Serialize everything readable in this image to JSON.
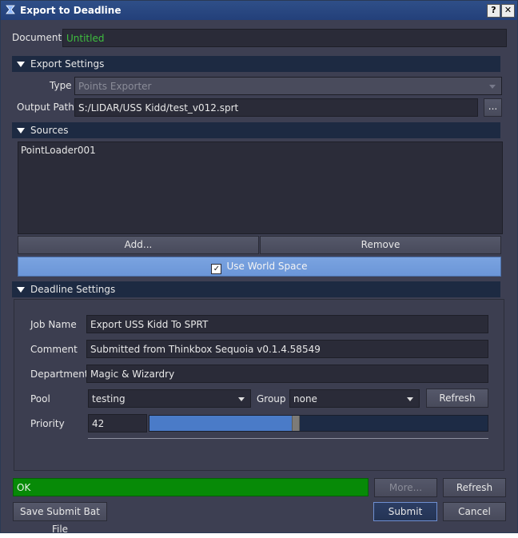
{
  "window": {
    "title": "Export to Deadline",
    "help_button": "?",
    "close_button": "✕"
  },
  "document": {
    "label": "Document",
    "value": "Untitled",
    "value_color": "#3fbf3f"
  },
  "export_settings": {
    "header": "Export Settings",
    "type_label": "Type",
    "type_value": "Points Exporter",
    "output_label": "Output Path",
    "output_value": "S:/LIDAR/USS Kidd/test_v012.sprt",
    "browse_label": "..."
  },
  "sources": {
    "header": "Sources",
    "items": [
      "PointLoader001"
    ],
    "add_label": "Add...",
    "remove_label": "Remove",
    "world_space_label": "Use World Space",
    "world_space_checked": true
  },
  "deadline_settings": {
    "header": "Deadline Settings",
    "job_name_label": "Job Name",
    "job_name_value": "Export USS Kidd To SPRT",
    "comment_label": "Comment",
    "comment_value": "Submitted from Thinkbox Sequoia v0.1.4.58549",
    "department_label": "Department",
    "department_value": "Magic & Wizardry",
    "pool_label": "Pool",
    "pool_value": "testing",
    "group_label": "Group",
    "group_value": "none",
    "refresh_label": "Refresh",
    "priority_label": "Priority",
    "priority_value": "42",
    "priority_fraction": 0.42
  },
  "status": {
    "text": "OK",
    "color": "#078a07"
  },
  "footer": {
    "more_label": "More...",
    "refresh_label": "Refresh",
    "save_bat_label": "Save Submit Bat File",
    "submit_label": "Submit",
    "cancel_label": "Cancel"
  },
  "colors": {
    "accent": "#6b96d8",
    "slider_fill": "#4a7bc8",
    "slider_track": "#1d2b45"
  }
}
